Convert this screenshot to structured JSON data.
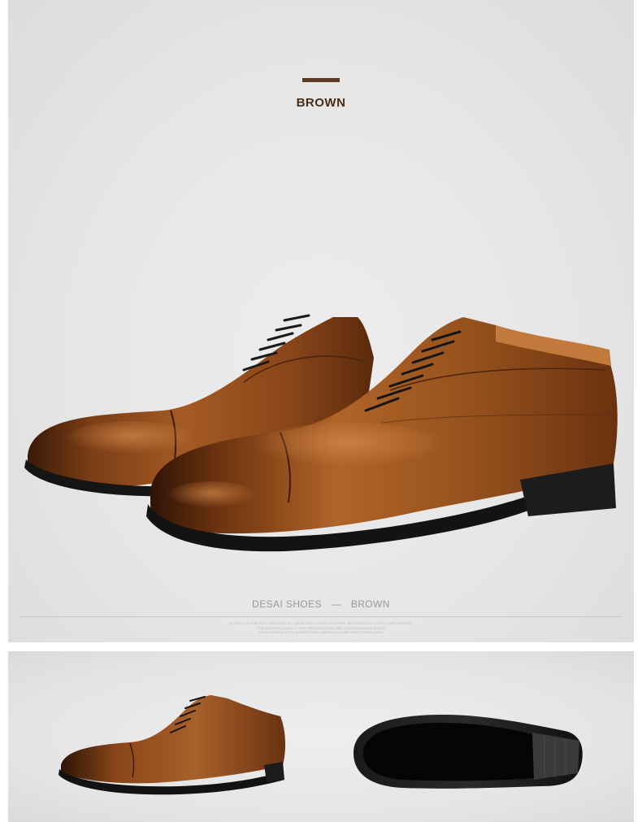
{
  "header": {
    "color_name": "BROWN",
    "accent_color": "#5a3a22"
  },
  "caption": {
    "brand": "DESAI SHOES",
    "dash": "—",
    "color": "BROWN"
  },
  "fine_print": [
    "TO GIVE YOU THE BEST SHOES ONE OF THE WORLD'S FINEST LEATHERS, INCLUDING ITALY, DUTCH, AND FRENCH...",
    "THE COUNTRY'S QUALITY FOR PROPOSING THE VERY BEST HANDMADE SHOES",
    "RIGHT MADE IN STYLE MASTER SHOE MAKERS ACCOMPLISHED FIRST-CLASS"
  ],
  "images": {
    "hero": "pair-of-brown-cap-toe-oxford-shoes",
    "side_view": "single-brown-oxford-side-view",
    "sole_view": "black-leather-sole-view"
  },
  "colors": {
    "leather": "#8a4a1f",
    "leather_dark": "#3a1a08",
    "sole": "#1a1a1a",
    "background": "#e8e8e8"
  }
}
